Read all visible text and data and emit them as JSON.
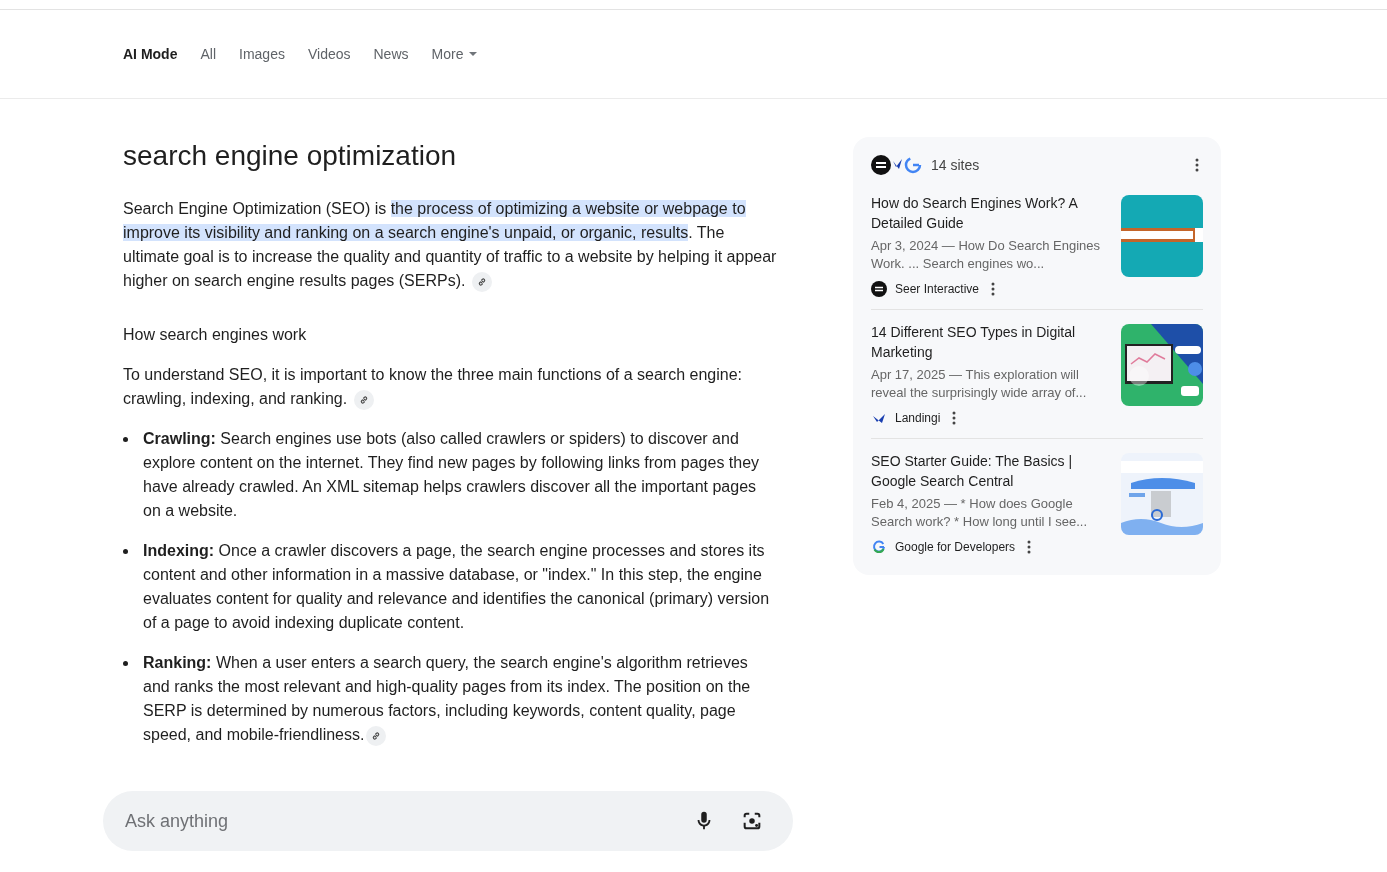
{
  "tabs": [
    {
      "label": "AI Mode",
      "selected": true
    },
    {
      "label": "All",
      "selected": false
    },
    {
      "label": "Images",
      "selected": false
    },
    {
      "label": "Videos",
      "selected": false
    },
    {
      "label": "News",
      "selected": false
    },
    {
      "label": "More",
      "selected": false,
      "dropdown": true
    }
  ],
  "answer": {
    "title": "search engine optimization",
    "intro": {
      "before": "Search Engine Optimization (SEO) is ",
      "highlight": "the process of optimizing a website or webpage to improve its visibility and ranking on a search engine's unpaid, or organic, results",
      "after": ". The ultimate goal is to increase the quality and quantity of traffic to a website by helping it appear higher on search engine results pages (SERPs)."
    },
    "heading": "How search engines work",
    "lead": "To understand SEO, it is important to know the three main functions of a search engine: crawling, indexing, and ranking.",
    "bullets": [
      {
        "text": "**Crawling:** Search engines use bots (also called crawlers or spiders) to discover and explore content on the internet. They find new pages by following links from pages they have already crawled. An XML sitemap helps crawlers discover all the important pages on a website.",
        "link": false
      },
      {
        "text": "**Indexing:** Once a crawler discovers a page, the search engine processes and stores its content and other information in a massive database, or \"index.\" In this step, the engine evaluates content for quality and relevance and identifies the canonical (primary) version of a page to avoid indexing duplicate content.",
        "link": false
      },
      {
        "text": "**Ranking:** When a user enters a search query, the search engine's algorithm retrieves and ranks the most relevant and high-quality pages from its index. The position on the SERP is determined by numerous factors, including keywords, content quality, page speed, and mobile-friendliness.",
        "link": true
      }
    ]
  },
  "ask": {
    "placeholder": "Ask anything"
  },
  "sources": {
    "count": "14 sites",
    "items": [
      {
        "title": "How do Search Engines Work? A Detailed Guide",
        "snippet": "Apr 3, 2024 — How Do Search Engines Work. ... Search engines wo...",
        "site": "Seer Interactive"
      },
      {
        "title": "14 Different SEO Types in Digital Marketing",
        "snippet": "Apr 17, 2025 — This exploration will reveal the surprisingly wide array of...",
        "site": "Landingi"
      },
      {
        "title": "SEO Starter Guide: The Basics | Google Search Central",
        "snippet": "Feb 4, 2025 — * How does Google Search work? * How long until I see...",
        "site": "Google for Developers"
      }
    ]
  }
}
